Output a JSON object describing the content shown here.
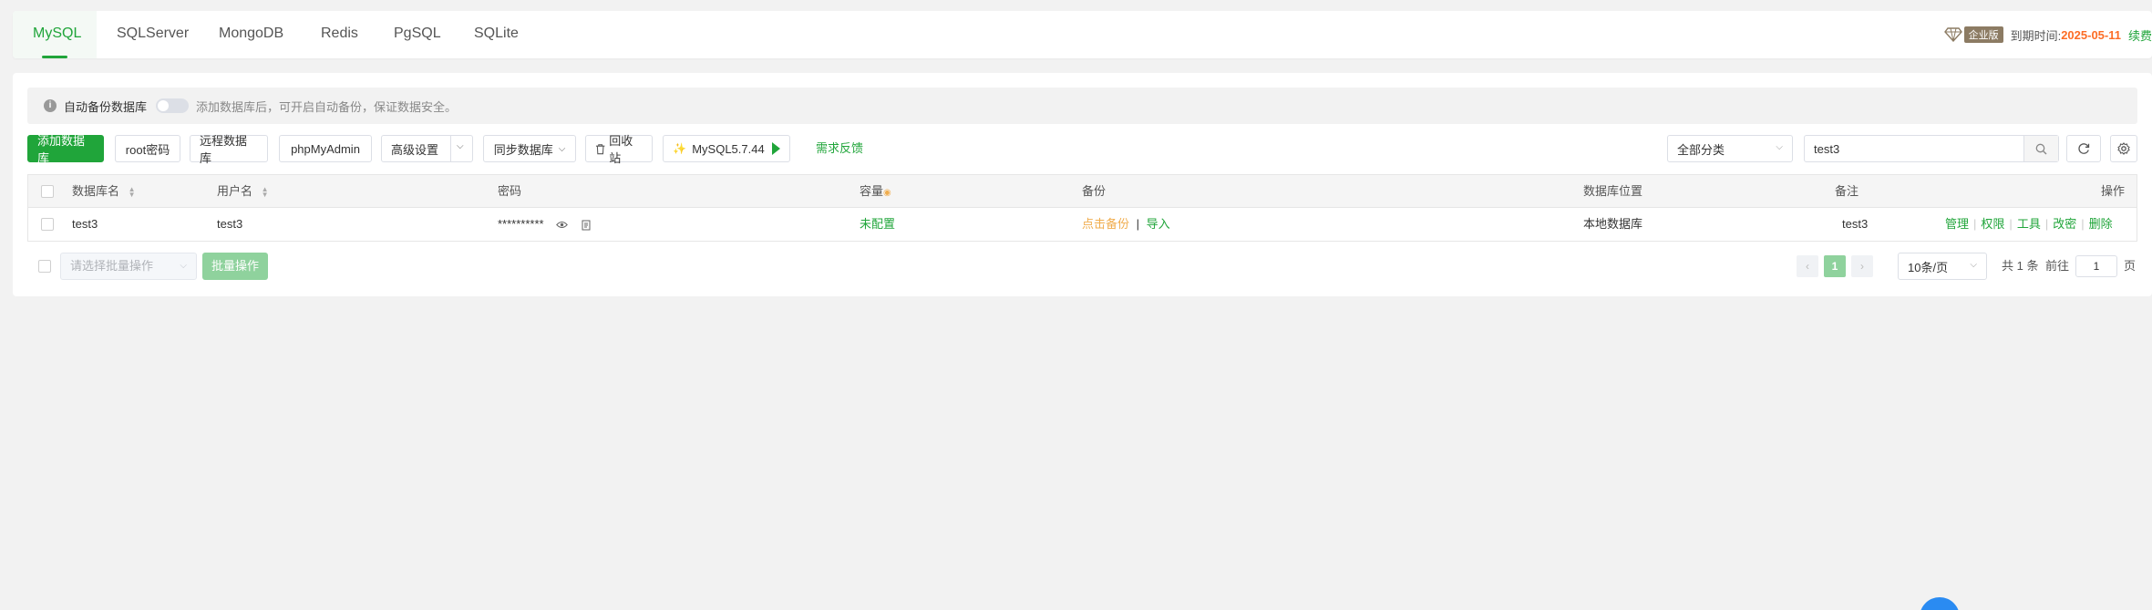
{
  "tabs": [
    {
      "label": "MySQL",
      "active": true
    },
    {
      "label": "SQLServer"
    },
    {
      "label": "MongoDB"
    },
    {
      "label": "Redis"
    },
    {
      "label": "PgSQL"
    },
    {
      "label": "SQLite"
    }
  ],
  "license": {
    "badge": "企业版",
    "expire_label": "到期时间:",
    "expire_date": "2025-05-11",
    "renew": "续费"
  },
  "notice": {
    "label": "自动备份数据库",
    "tip": "添加数据库后，可开启自动备份，保证数据安全。"
  },
  "toolbar": {
    "add_db": "添加数据库",
    "root_pwd": "root密码",
    "remote_db": "远程数据库",
    "phpmyadmin": "phpMyAdmin",
    "advanced": "高级设置",
    "sync_db": "同步数据库",
    "recycle": "回收站",
    "mysql_version": "MySQL5.7.44",
    "feedback": "需求反馈",
    "category": "全部分类",
    "search_value": "test3"
  },
  "table": {
    "headers": {
      "name": "数据库名",
      "user": "用户名",
      "password": "密码",
      "capacity": "容量",
      "backup": "备份",
      "location": "数据库位置",
      "note": "备注",
      "actions": "操作"
    },
    "rows": [
      {
        "name": "test3",
        "user": "test3",
        "password": "**********",
        "capacity": "未配置",
        "backup_action": "点击备份",
        "backup_sep": "|",
        "import": "导入",
        "location": "本地数据库",
        "note": "test3",
        "actions": [
          "管理",
          "权限",
          "工具",
          "改密",
          "删除"
        ]
      }
    ]
  },
  "footer": {
    "batch_placeholder": "请选择批量操作",
    "batch_button": "批量操作",
    "current_page": "1",
    "page_size": "10条/页",
    "total": "共 1 条",
    "goto": "前往",
    "goto_page": "1",
    "page_unit": "页"
  },
  "colors": {
    "accent": "#20a53a",
    "warning": "#f0ad4e",
    "expire": "#fc6d26"
  }
}
